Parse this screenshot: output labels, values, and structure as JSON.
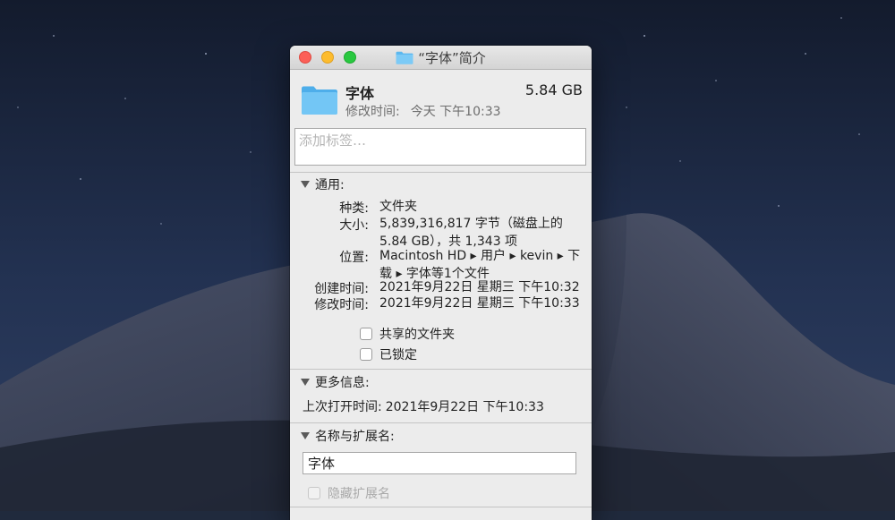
{
  "window": {
    "title": "“字体”简介",
    "title_icon": "folder-icon"
  },
  "file": {
    "icon": "folder-icon",
    "name": "字体",
    "size": "5.84 GB",
    "modified_label": "修改时间:",
    "modified_value": "今天 下午10:33"
  },
  "tags": {
    "placeholder": "添加标签…"
  },
  "general": {
    "header": "通用:",
    "kind_label": "种类:",
    "kind_value": "文件夹",
    "size_label": "大小:",
    "size_value": "5,839,316,817 字节（磁盘上的 5.84 GB），共 1,343 项",
    "where_label": "位置:",
    "where_value": "Macintosh HD ▸ 用户 ▸ kevin ▸ 下载 ▸ 字体等1个文件",
    "created_label": "创建时间:",
    "created_value": "2021年9月22日 星期三 下午10:32",
    "modified_label": "修改时间:",
    "modified_value": "2021年9月22日 星期三 下午10:33",
    "shared_folder_label": "共享的文件夹",
    "shared_folder_checked": false,
    "locked_label": "已锁定",
    "locked_checked": false
  },
  "more_info": {
    "header": "更多信息:",
    "last_opened_label": "上次打开时间:",
    "last_opened_value": "2021年9月22日 下午10:33"
  },
  "name_extension": {
    "header": "名称与扩展名:",
    "name_value": "字体",
    "hide_extension_label": "隐藏扩展名",
    "hide_extension_checked": false,
    "hide_extension_enabled": false
  },
  "colors": {
    "desktop_sky": "#1e2b44",
    "dune": "#3a4258",
    "close": "#fc5f57",
    "minimize": "#fdbc2e",
    "zoom": "#29c840",
    "folder": "#5cb8ef"
  }
}
